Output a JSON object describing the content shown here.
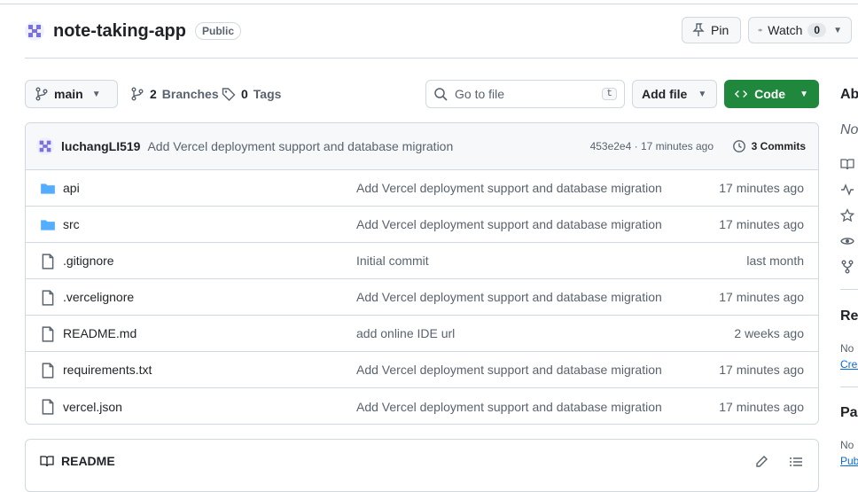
{
  "repo": {
    "name": "note-taking-app",
    "visibility": "Public"
  },
  "actions": {
    "pin_label": "Pin",
    "watch_label": "Watch",
    "watch_count": "0"
  },
  "toolbar": {
    "branch": "main",
    "branches_count": "2",
    "branches_label": "Branches",
    "tags_count": "0",
    "tags_label": "Tags",
    "search_placeholder": "Go to file",
    "search_shortcut": "t",
    "add_file_label": "Add file",
    "code_label": "Code"
  },
  "commit": {
    "author": "luchangLI519",
    "message": "Add Vercel deployment support and database migration",
    "meta": "453e2e4 · 17 minutes ago",
    "commits_label": "3 Commits"
  },
  "files": [
    {
      "type": "folder",
      "name": "api",
      "message": "Add Vercel deployment support and database migration",
      "time": "17 minutes ago"
    },
    {
      "type": "folder",
      "name": "src",
      "message": "Add Vercel deployment support and database migration",
      "time": "17 minutes ago"
    },
    {
      "type": "file",
      "name": ".gitignore",
      "message": "Initial commit",
      "time": "last month"
    },
    {
      "type": "file",
      "name": ".vercelignore",
      "message": "Add Vercel deployment support and database migration",
      "time": "17 minutes ago"
    },
    {
      "type": "file",
      "name": "README.md",
      "message": "add online IDE url",
      "time": "2 weeks ago"
    },
    {
      "type": "file",
      "name": "requirements.txt",
      "message": "Add Vercel deployment support and database migration",
      "time": "17 minutes ago"
    },
    {
      "type": "file",
      "name": "vercel.json",
      "message": "Add Vercel deployment support and database migration",
      "time": "17 minutes ago"
    }
  ],
  "readme": {
    "title": "README"
  },
  "sidebar": {
    "about_heading": "Ab",
    "about_text": "No",
    "releases_heading": "Rel",
    "releases_text": "No",
    "releases_link": "Crea",
    "packages_heading": "Pac",
    "packages_text": "No",
    "packages_link": "Pub"
  },
  "colors": {
    "accent_green": "#1f883d",
    "folder_blue": "#54aeff",
    "link_blue": "#0969da"
  }
}
